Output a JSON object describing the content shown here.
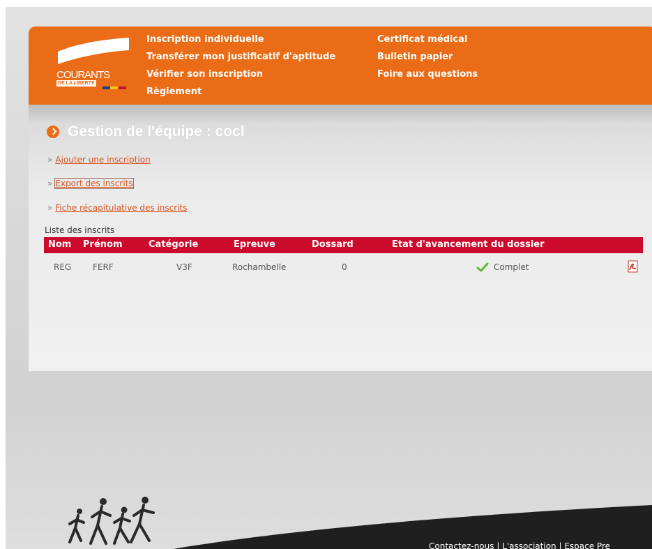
{
  "logo": {
    "name_line1": "COURANTS",
    "name_line2": "DE LA LIBERTÉ"
  },
  "nav": {
    "col1": [
      "Inscription individuelle",
      "Transférer mon justificatif d'aptitude",
      "Vérifier son inscription",
      "Règlement"
    ],
    "col2": [
      "Certificat médical",
      "Bulletin papier",
      "Foire aux questions"
    ]
  },
  "page_title": "Gestion de l'équipe : cocl",
  "actions": {
    "add_registration": "Ajouter une inscription",
    "export_registrants": "Export des inscrits",
    "summary_sheet": "Fiche récapitulative des inscrits"
  },
  "list_caption": "Liste des inscrits",
  "table": {
    "columns": [
      "Nom",
      "Prénom",
      "Catégorie",
      "Epreuve",
      "Dossard",
      "Etat d'avancement du dossier"
    ],
    "rows": [
      {
        "nom": "REG",
        "prenom": "FERF",
        "categorie": "V3F",
        "epreuve": "Rochambelle",
        "dossard": "0",
        "etat": "Complet"
      }
    ]
  },
  "footer": {
    "contact": "Contactez-nous",
    "association": "L'association",
    "press": "Espace Pre"
  },
  "icons": {
    "title_bullet": "chevron-right-circle-icon",
    "status": "checkmark-icon",
    "document": "pdf-icon"
  },
  "colors": {
    "brand_orange": "#ea6c16",
    "table_header_red": "#cc0a2c",
    "link": "#d9541e",
    "check_green": "#5fb832"
  }
}
